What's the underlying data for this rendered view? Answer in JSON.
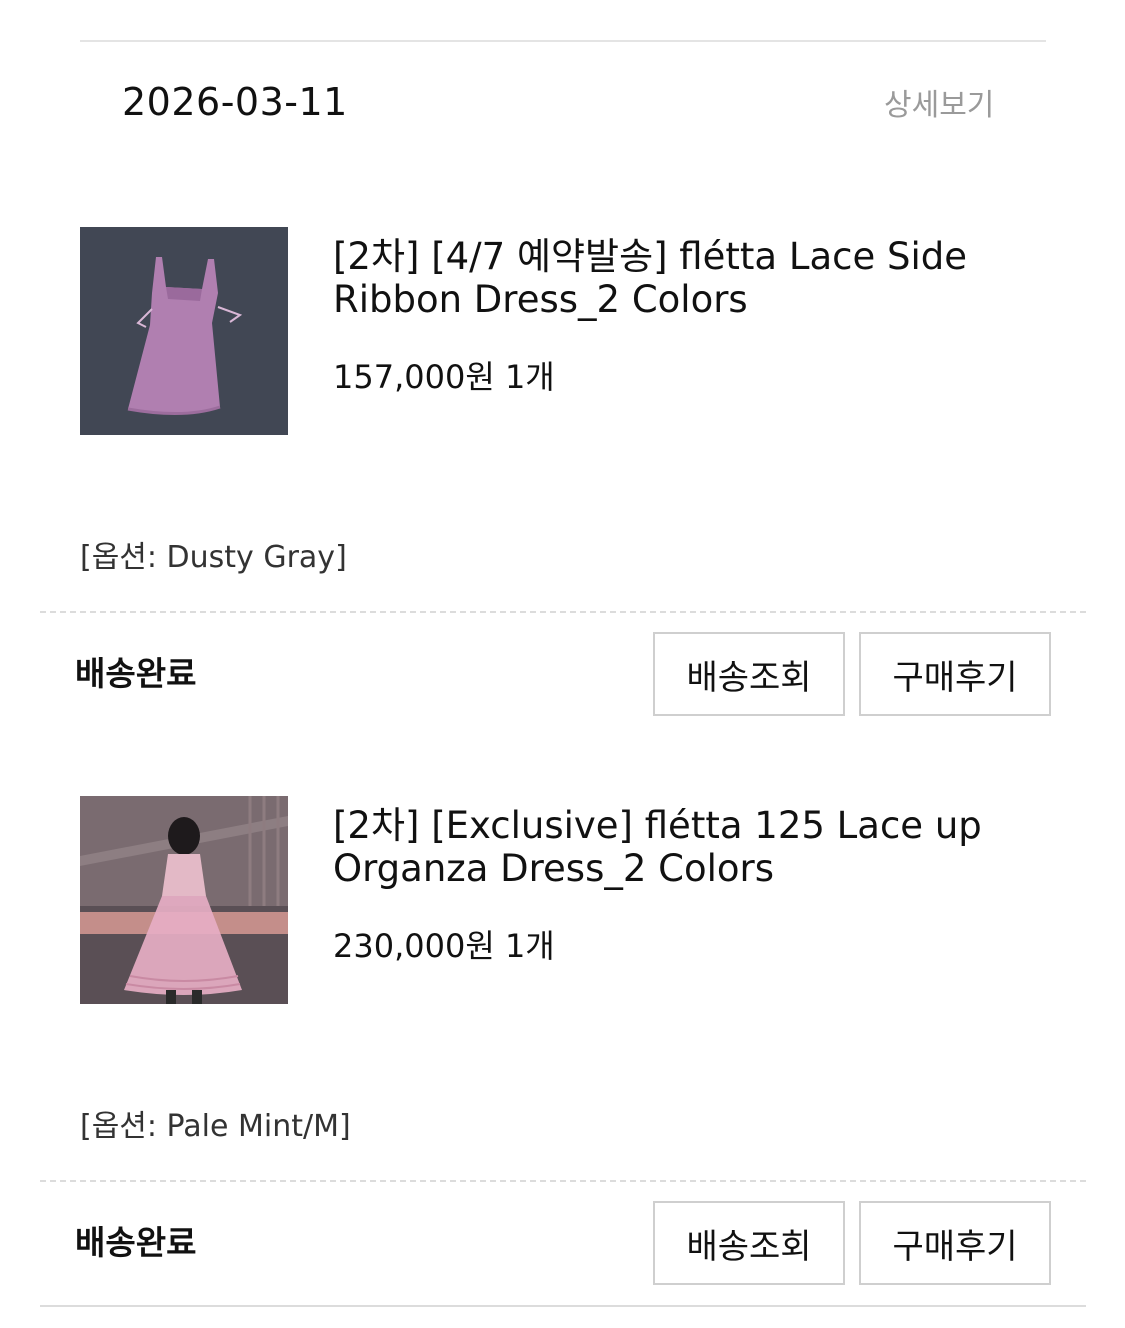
{
  "order": {
    "date": "2026-03-11",
    "detail_link": "상세보기"
  },
  "items": [
    {
      "image": "lavender-slip-dress-photo",
      "name_line1": "[2차] [4/7 예약발송] flétta Lace Side",
      "name_line2": "Ribbon Dress_2 Colors",
      "price": "157,000원 1개",
      "option": "[옵션: Dusty Gray]",
      "status": "배송완료",
      "track_button": "배송조회",
      "review_button": "구매후기"
    },
    {
      "image": "pink-organza-dress-photo",
      "name_line1": "[2차] [Exclusive] flétta 125 Lace up",
      "name_line2": "Organza Dress_2 Colors",
      "price": "230,000원 1개",
      "option": "[옵션: Pale Mint/M]",
      "status": "배송완료",
      "track_button": "배송조회",
      "review_button": "구매후기"
    }
  ]
}
